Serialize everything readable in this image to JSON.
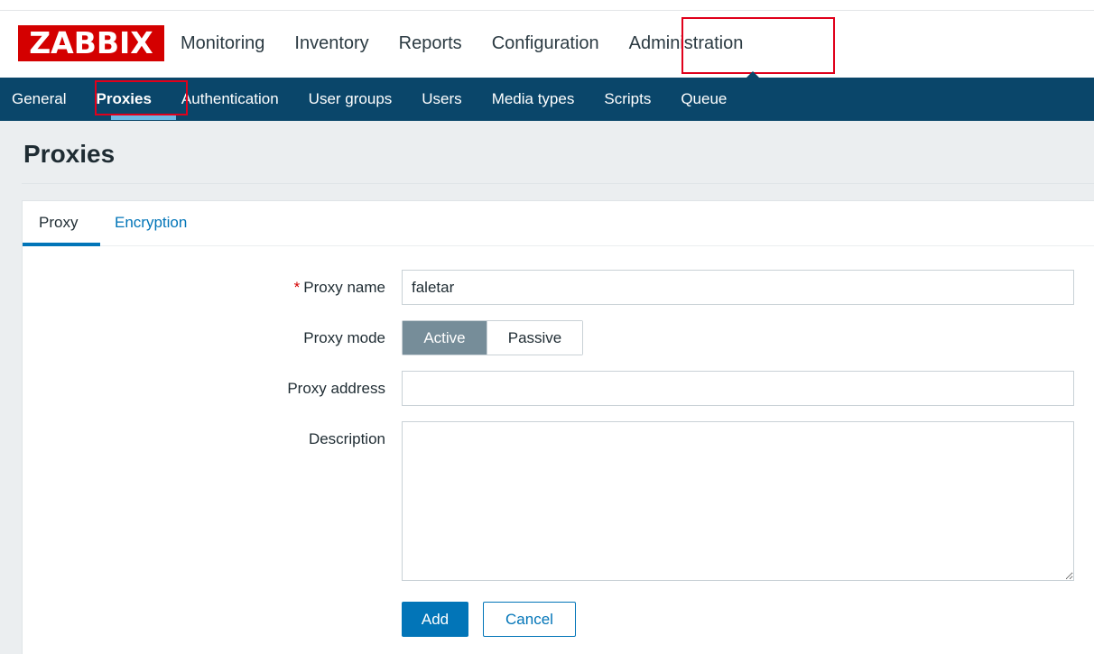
{
  "brand": {
    "logo_text": "ZABBIX",
    "color": "#d40000"
  },
  "top_nav": {
    "items": [
      {
        "label": "Monitoring"
      },
      {
        "label": "Inventory"
      },
      {
        "label": "Reports"
      },
      {
        "label": "Configuration"
      },
      {
        "label": "Administration",
        "selected": true
      }
    ]
  },
  "sub_nav": {
    "background": "#0a466a",
    "items": [
      {
        "label": "General"
      },
      {
        "label": "Proxies",
        "selected": true
      },
      {
        "label": "Authentication"
      },
      {
        "label": "User groups"
      },
      {
        "label": "Users"
      },
      {
        "label": "Media types"
      },
      {
        "label": "Scripts"
      },
      {
        "label": "Queue"
      }
    ]
  },
  "page": {
    "title": "Proxies"
  },
  "tabs": [
    {
      "label": "Proxy",
      "selected": true
    },
    {
      "label": "Encryption"
    }
  ],
  "form": {
    "proxy_name": {
      "label": "Proxy name",
      "required_marker": "*",
      "value": "faletar"
    },
    "proxy_mode": {
      "label": "Proxy mode",
      "options": [
        "Active",
        "Passive"
      ],
      "selected": "Active"
    },
    "proxy_address": {
      "label": "Proxy address",
      "value": ""
    },
    "description": {
      "label": "Description",
      "value": ""
    },
    "buttons": {
      "add": "Add",
      "cancel": "Cancel"
    }
  },
  "annotation_color": "#e0001b"
}
